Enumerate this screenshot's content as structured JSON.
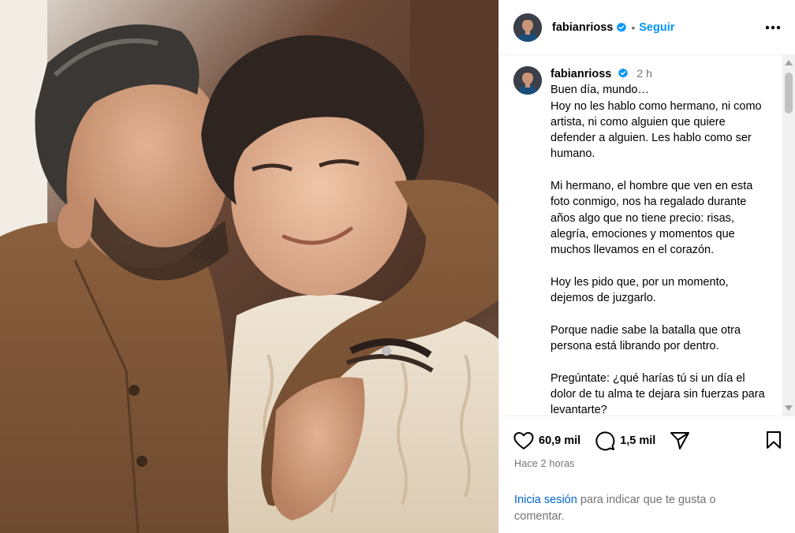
{
  "post": {
    "username": "fabianrioss",
    "verified": true,
    "follow_label": "Seguir",
    "separator": "•",
    "more_icon": "more-horizontal-icon"
  },
  "caption": {
    "username": "fabianrioss",
    "time": "2 h",
    "text": "Buen día, mundo…\nHoy no les hablo como hermano, ni como artista, ni como alguien que quiere defender a alguien. Les hablo como ser humano.\n\nMi hermano, el hombre que ven en esta foto conmigo, nos ha regalado durante años algo que no tiene precio: risas, alegría, emociones y momentos que muchos llevamos en el corazón.\n\nHoy les pido que, por un momento, dejemos de juzgarlo.\n\nPorque nadie sabe la batalla que otra persona está librando por dentro.\n\nPregúntate: ¿qué harías tú si un día el dolor de tu alma te dejara sin fuerzas para levantarte?"
  },
  "actions": {
    "likes": "60,9 mil",
    "comments": "1,5 mil",
    "like_icon": "heart-icon",
    "comment_icon": "comment-icon",
    "share_icon": "share-icon",
    "save_icon": "bookmark-icon"
  },
  "timestamp": "Hace 2 horas",
  "login_prompt": {
    "link": "Inicia sesión",
    "rest": " para indicar que te gusta o comentar."
  },
  "colors": {
    "accent": "#0095f6",
    "secondary_text": "#737373",
    "link": "#0064d1",
    "verified": "#0095f6"
  }
}
